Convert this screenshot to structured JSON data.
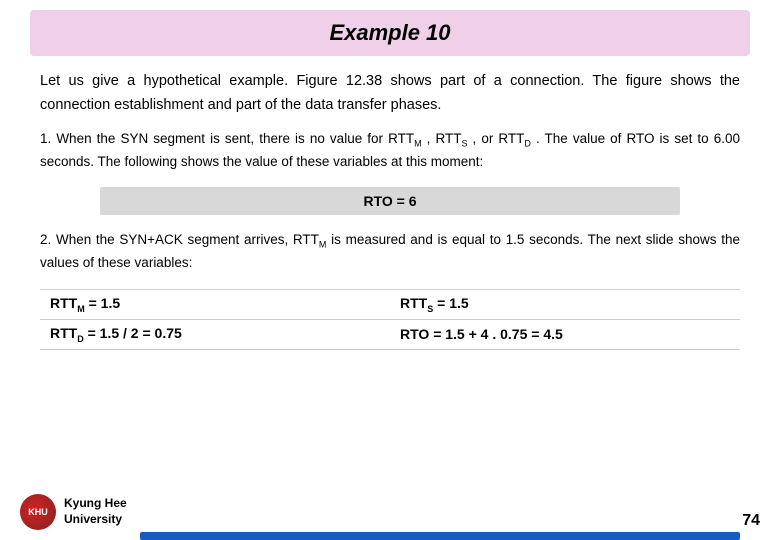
{
  "title": "Example 10",
  "intro": "Let us give a hypothetical example. Figure 12.38 shows part of a connection. The figure shows the connection establishment and part of the data transfer phases.",
  "step1": {
    "text": "1. When the SYN segment is sent, there is no value for RTT",
    "sub_M": "M",
    "text2": " , RTT",
    "sub_S": "S",
    "text3": " , or RTT",
    "sub_D": "D",
    "text4": " . The value of RTO is set to 6.00 seconds. The following shows the value of these variables at this moment:"
  },
  "rto_box": "RTO = 6",
  "step2": {
    "text": "2. When the SYN+ACK segment arrives, RTT",
    "sub_M": "M",
    "text2": " is measured and is equal to 1.5 seconds. The next slide shows the values of these variables:"
  },
  "variables": [
    {
      "left": "RTT",
      "left_sub": "M",
      "left_val": " = 1.5",
      "right": "RTT",
      "right_sub": "S",
      "right_val": " = 1.5"
    },
    {
      "left": "RTT",
      "left_sub": "D",
      "left_val": " = 1.5 / 2 = 0.75",
      "right": "RTO",
      "right_sub": "",
      "right_val": " = 1.5 + 4 . 0.75 = 4.5"
    }
  ],
  "footer": {
    "school_line1": "Kyung Hee",
    "school_line2": "University",
    "page_number": "74"
  }
}
